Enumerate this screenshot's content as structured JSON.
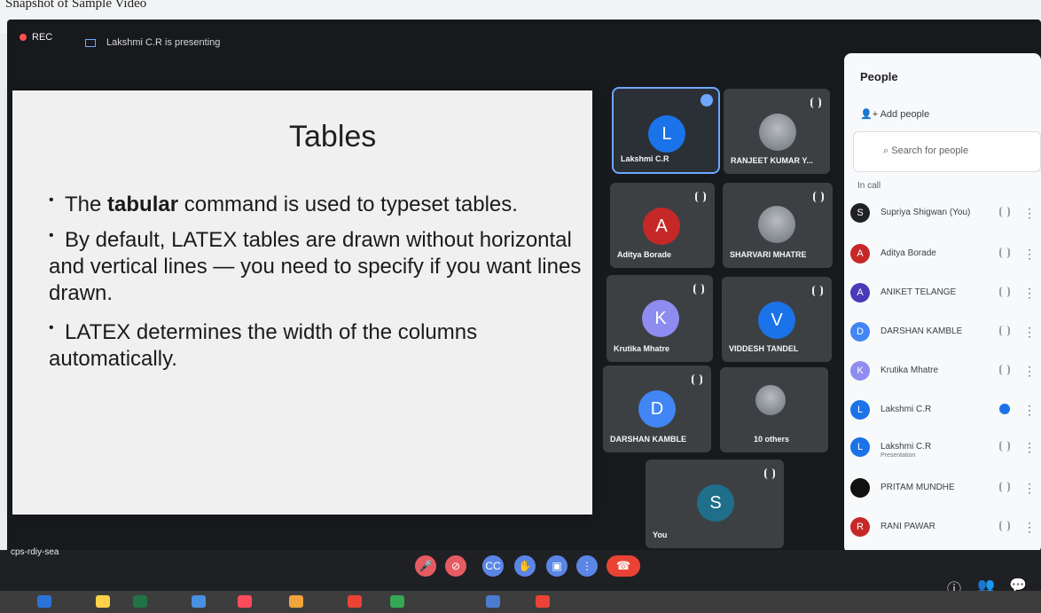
{
  "caption": "Snapshot of Sample Video",
  "meeting": {
    "rec_label": "REC",
    "presenting_text": "Lakshmi C.R is presenting",
    "code": "cps-rdiy-sea"
  },
  "slide": {
    "title": "Tables",
    "bullets": [
      "The tabular command is used to typeset tables.",
      "By default, LATEX tables are drawn without horizontal and vertical lines — you need to specify if you want lines drawn.",
      "LATEX determines the width of the columns automatically."
    ],
    "highlight_word": "tabular"
  },
  "tiles": [
    {
      "name": "Lakshmi C.R",
      "initial": "L",
      "color": "#1a73e8",
      "active": true
    },
    {
      "name": "RANJEET KUMAR Y...",
      "initial": "",
      "color": "#7a8086"
    },
    {
      "name": "Aditya Borade",
      "initial": "A",
      "color": "#c62828"
    },
    {
      "name": "SHARVARI MHATRE",
      "initial": "",
      "color": "#7a8086"
    },
    {
      "name": "Krutika Mhatre",
      "initial": "K",
      "color": "#8e8cf0"
    },
    {
      "name": "VIDDESH TANDEL",
      "initial": "V",
      "color": "#1a73e8"
    },
    {
      "name": "DARSHAN KAMBLE",
      "initial": "D",
      "color": "#4285f4"
    },
    {
      "name": "10 others",
      "initial": "",
      "color": "#7a8086"
    },
    {
      "name": "You",
      "initial": "S",
      "color": "#1f6f8b"
    }
  ],
  "people_panel": {
    "title": "People",
    "add_people": "Add people",
    "search_placeholder": "Search for people",
    "section": "In call",
    "people": [
      {
        "name": "Supriya Shigwan (You)",
        "initial": "S",
        "color": "#202124",
        "sub": ""
      },
      {
        "name": "Aditya Borade",
        "initial": "A",
        "color": "#c62828",
        "sub": ""
      },
      {
        "name": "ANIKET TELANGE",
        "initial": "A",
        "color": "#4a39b8",
        "sub": ""
      },
      {
        "name": "DARSHAN KAMBLE",
        "initial": "D",
        "color": "#4285f4",
        "sub": ""
      },
      {
        "name": "Krutika Mhatre",
        "initial": "K",
        "color": "#8e8cf0",
        "sub": ""
      },
      {
        "name": "Lakshmi C.R",
        "initial": "L",
        "color": "#1a73e8",
        "sub": "",
        "speaking": true
      },
      {
        "name": "Lakshmi C.R",
        "initial": "L",
        "color": "#1a73e8",
        "sub": "Presentation"
      },
      {
        "name": "PRITAM MUNDHE",
        "initial": "",
        "color": "#111111",
        "sub": ""
      },
      {
        "name": "RANI PAWAR",
        "initial": "R",
        "color": "#c62828",
        "sub": ""
      }
    ]
  }
}
